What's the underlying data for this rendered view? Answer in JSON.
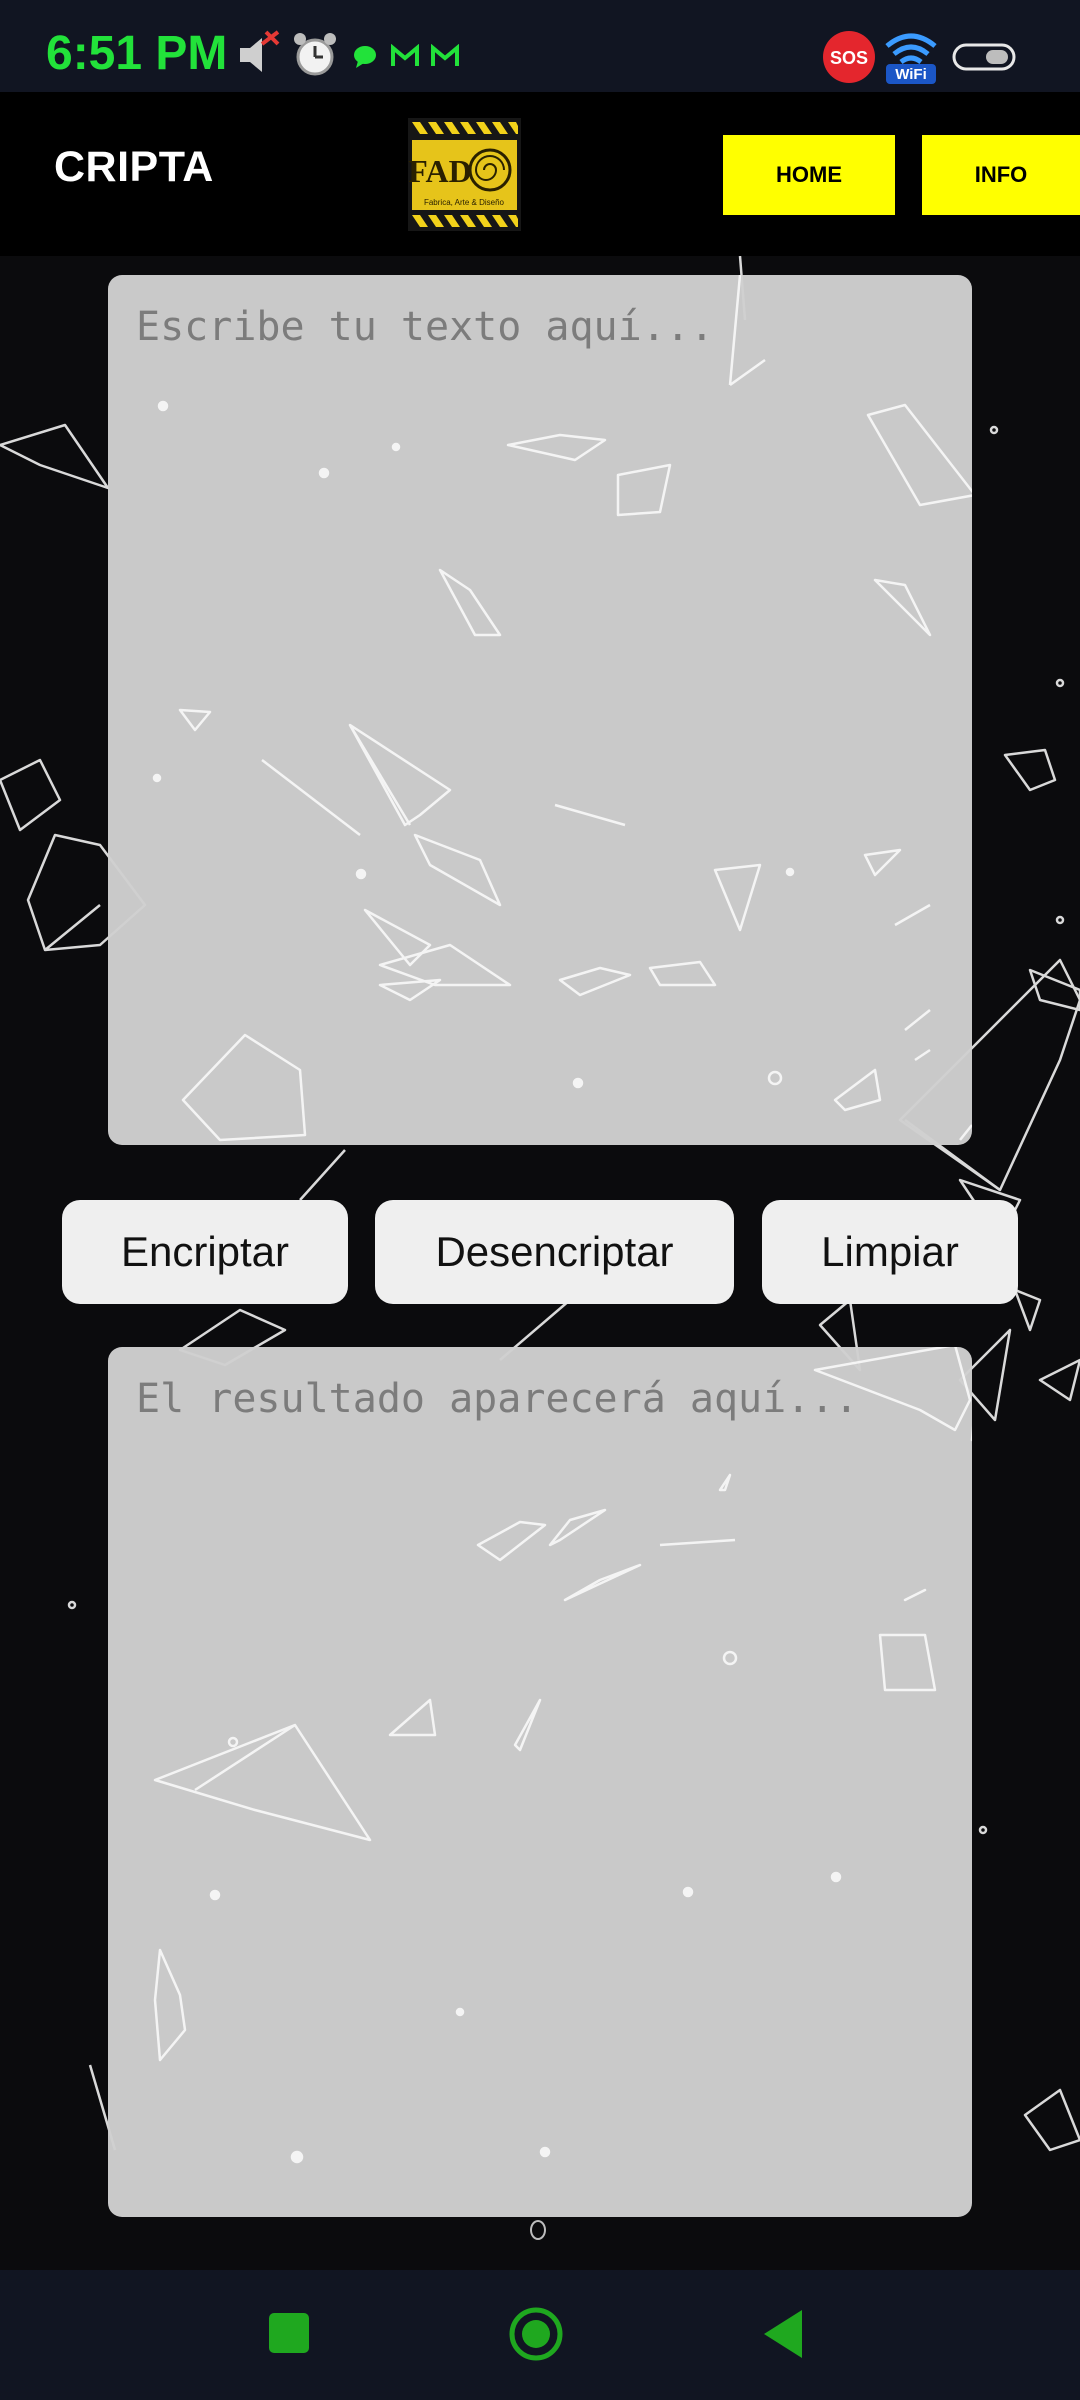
{
  "status_bar": {
    "time": "6:51 PM",
    "sos_label": "SOS",
    "wifi_label": "WiFi",
    "icons": [
      "speaker-muted-icon",
      "alarm-clock-icon",
      "chat-bubble-icon",
      "gmail-icon",
      "gmail-icon",
      "sos-icon",
      "wifi-icon",
      "battery-icon"
    ]
  },
  "header": {
    "title": "CRIPTA",
    "logo_text": "FAD",
    "logo_caption": "Fabrica, Arte & Diseño",
    "nav": [
      {
        "label": "HOME"
      },
      {
        "label": "INFO"
      }
    ]
  },
  "input": {
    "placeholder": "Escribe tu texto aquí...",
    "value": ""
  },
  "actions": {
    "encrypt_label": "Encriptar",
    "decrypt_label": "Desencriptar",
    "clear_label": "Limpiar"
  },
  "output": {
    "placeholder": "El resultado aparecerá aquí...",
    "value": ""
  },
  "colors": {
    "accent_yellow": "#ffff00",
    "clock_green": "#22e23a",
    "nav_green": "#1fa81f",
    "background": "#0b0b0d",
    "textarea_bg": "#d0d0d0"
  },
  "system_nav": {
    "icons": [
      "recent-apps-icon",
      "home-icon",
      "back-icon"
    ]
  }
}
